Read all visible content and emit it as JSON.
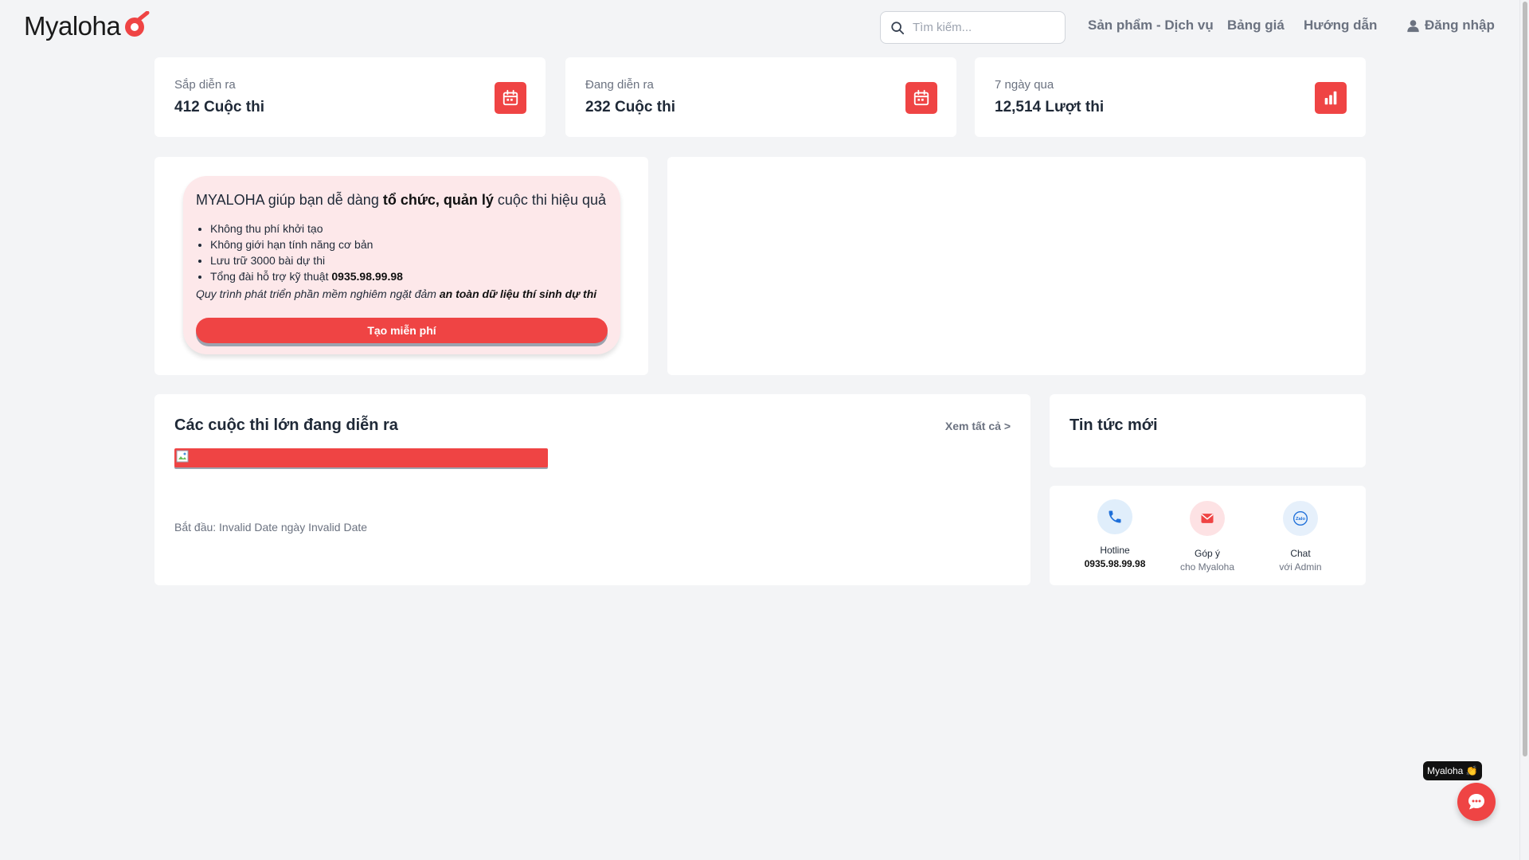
{
  "header": {
    "logo_text": "Myaloha",
    "search_placeholder": "Tìm kiếm...",
    "nav": [
      "Sản phẩm - Dịch vụ",
      "Bảng giá",
      "Hướng dẫn"
    ],
    "login_label": "Đăng nhập"
  },
  "stats": [
    {
      "label": "Sắp diễn ra",
      "number": "412",
      "unit": "Cuộc thi",
      "icon": "calendar-icon"
    },
    {
      "label": "Đang diễn ra",
      "number": "232",
      "unit": "Cuộc thi",
      "icon": "calendar-icon"
    },
    {
      "label": "7 ngày qua",
      "number": "12,514",
      "unit": "Lượt thi",
      "icon": "bar-chart-icon"
    }
  ],
  "promo": {
    "title_prefix": "MYALOHA giúp bạn dễ dàng ",
    "title_bold": "tổ chức, quản lý",
    "title_suffix": " cuộc thi hiệu quả",
    "bullets": [
      "Không thu phí khởi tạo",
      "Không giới hạn tính năng cơ bản",
      "Lưu trữ 3000 bài dự thi"
    ],
    "hotline_prefix": "Tổng đài hỗ trợ kỹ thuật ",
    "hotline_number": "0935.98.99.98",
    "note_prefix": "Quy trình phát triển phần mềm nghiêm ngặt đảm ",
    "note_bold": "an toàn dữ liệu thí sinh dự thi",
    "button_label": "Tạo miễn phí"
  },
  "contests": {
    "title": "Các cuộc thi lớn đang diễn ra",
    "see_all": "Xem tất cả >",
    "date_text": "Bắt đầu: Invalid Date ngày Invalid Date"
  },
  "news": {
    "title": "Tin tức mới"
  },
  "contact": [
    {
      "title": "Hotline",
      "sub": "0935.98.99.98",
      "icon": "phone-icon"
    },
    {
      "title": "Góp ý",
      "sub": "cho Myaloha",
      "icon": "mail-icon"
    },
    {
      "title": "Chat",
      "sub": "với Admin",
      "icon": "zalo-icon"
    }
  ],
  "chat_widget": {
    "tag": "Myaloha 👏"
  },
  "colors": {
    "accent": "#ef4444",
    "promo_bg": "#fde8ea",
    "page_bg": "#f3f4f6"
  }
}
